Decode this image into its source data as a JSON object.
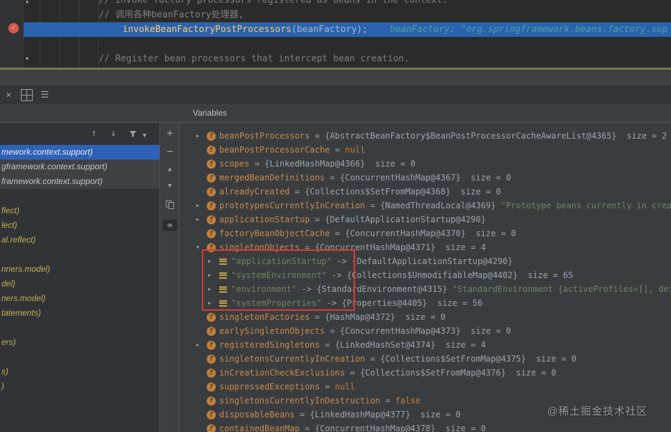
{
  "watermark": "@稀土掘金技术社区",
  "colors": {
    "execution_line_bg": "#2a62ae",
    "breakpoint_red": "#d5574e",
    "frame_selection_bg": "#2e62b8",
    "annotation_box_red": "#e0392f",
    "string_green": "#6a8759",
    "variable_name_orange": "#c98a4b",
    "keyword_orange": "#cc7832",
    "comment_gray": "#7f7f7f",
    "library_frame_yellow": "#c7ae4e"
  },
  "editor": {
    "lines": [
      "// invoke factory processors registered as beans in the context.",
      "// 调用各种beanFactory处理器,",
      "",
      "// Register bean processors that intercept bean creation."
    ],
    "method_name": "invokeBeanFactoryPostProcessors",
    "method_rest": "(beanFactory);",
    "inline_hint": "beanFactory: \"org.springframework.beans.factory.sup",
    "icons": [
      "fold-arrow-icon",
      "verified-breakpoint-icon"
    ]
  },
  "debug": {
    "variables_label": "Variables",
    "left_toolbar_icons": [
      "close-icon",
      "grid-layout-icon",
      "list-layout-icon"
    ],
    "frames_toolbar_icons": [
      "up-arrow-icon",
      "down-arrow-icon",
      "filter-funnel-icon",
      "chevron-down-icon"
    ],
    "side_toolbar_icons": [
      "add-watch-icon",
      "remove-watch-icon",
      "scroll-up-icon",
      "scroll-down-icon",
      "duplicate-icon",
      "evaluate-infinity-icon"
    ],
    "frames": [
      {
        "text": "mework.context.support)",
        "kind": "selected"
      },
      {
        "text": "gframework.context.support)",
        "kind": "normal"
      },
      {
        "text": "framework.context.support)",
        "kind": "normal"
      },
      {
        "text": "",
        "kind": "blank"
      },
      {
        "text": "flect)",
        "kind": "lib"
      },
      {
        "text": "lect)",
        "kind": "lib"
      },
      {
        "text": "al.reflect)",
        "kind": "lib"
      },
      {
        "text": "",
        "kind": "blank"
      },
      {
        "text": "nners.model)",
        "kind": "lib"
      },
      {
        "text": "del)",
        "kind": "lib"
      },
      {
        "text": "ners.model)",
        "kind": "lib"
      },
      {
        "text": "tatements)",
        "kind": "lib"
      },
      {
        "text": "",
        "kind": "blank"
      },
      {
        "text": "ers)",
        "kind": "lib"
      },
      {
        "text": "",
        "kind": "blank"
      },
      {
        "text": "s)",
        "kind": "lib"
      },
      {
        "text": ")",
        "kind": "lib"
      }
    ],
    "variables": [
      {
        "expand": "right",
        "kind": "field",
        "indent": 0,
        "name": "beanPostProcessors",
        "value": "{AbstractBeanFactory$BeanPostProcessorCacheAwareList@4365}",
        "size": "size = 2"
      },
      {
        "expand": "none",
        "kind": "field",
        "indent": 0,
        "name": "beanPostProcessorCache",
        "keyword": "null"
      },
      {
        "expand": "none",
        "kind": "field",
        "indent": 0,
        "name": "scopes",
        "value": "{LinkedHashMap@4366}",
        "size": "size = 0"
      },
      {
        "expand": "none",
        "kind": "field",
        "indent": 0,
        "name": "mergedBeanDefinitions",
        "value": "{ConcurrentHashMap@4367}",
        "size": "size = 0"
      },
      {
        "expand": "none",
        "kind": "field",
        "indent": 0,
        "name": "alreadyCreated",
        "value": "{Collections$SetFromMap@4368}",
        "size": "size = 0"
      },
      {
        "expand": "right",
        "kind": "field",
        "indent": 0,
        "name": "prototypesCurrentlyInCreation",
        "value": "{NamedThreadLocal@4369}",
        "string": "\"Prototype beans currently in creation\""
      },
      {
        "expand": "right",
        "kind": "field",
        "indent": 0,
        "name": "applicationStartup",
        "value": "{DefaultApplicationStartup@4290}"
      },
      {
        "expand": "none",
        "kind": "field",
        "indent": 0,
        "name": "factoryBeanObjectCache",
        "value": "{ConcurrentHashMap@4370}",
        "size": "size = 0"
      },
      {
        "expand": "down",
        "kind": "field",
        "indent": 0,
        "name": "singletonObjects",
        "value": "{ConcurrentHashMap@4371}",
        "size": "size = 4"
      },
      {
        "expand": "right",
        "kind": "entry",
        "indent": 1,
        "name": "\"applicationStartup\"",
        "value": "{DefaultApplicationStartup@4290}"
      },
      {
        "expand": "right",
        "kind": "entry",
        "indent": 1,
        "name": "\"systemEnvironment\"",
        "value": "{Collections$UnmodifiableMap@4402}",
        "size": "size = 65"
      },
      {
        "expand": "right",
        "kind": "entry",
        "indent": 1,
        "name": "\"environment\"",
        "value": "{StandardEnvironment@4315}",
        "string": "\"StandardEnvironment {activeProfiles=[], defaultProfiles=[de"
      },
      {
        "expand": "right",
        "kind": "entry",
        "indent": 1,
        "name": "\"systemProperties\"",
        "value": "{Properties@4405}",
        "size": "size = 56"
      },
      {
        "expand": "none",
        "kind": "field",
        "indent": 0,
        "name": "singletonFactories",
        "value": "{HashMap@4372}",
        "size": "size = 0"
      },
      {
        "expand": "none",
        "kind": "field",
        "indent": 0,
        "name": "earlySingletonObjects",
        "value": "{ConcurrentHashMap@4373}",
        "size": "size = 0"
      },
      {
        "expand": "right",
        "kind": "field",
        "indent": 0,
        "name": "registeredSingletons",
        "value": "{LinkedHashSet@4374}",
        "size": "size = 4"
      },
      {
        "expand": "none",
        "kind": "field",
        "indent": 0,
        "name": "singletonsCurrentlyInCreation",
        "value": "{Collections$SetFromMap@4375}",
        "size": "size = 0"
      },
      {
        "expand": "none",
        "kind": "field",
        "indent": 0,
        "name": "inCreationCheckExclusions",
        "value": "{Collections$SetFromMap@4376}",
        "size": "size = 0"
      },
      {
        "expand": "none",
        "kind": "field",
        "indent": 0,
        "name": "suppressedExceptions",
        "keyword": "null"
      },
      {
        "expand": "none",
        "kind": "field",
        "indent": 0,
        "name": "singletonsCurrentlyInDestruction",
        "keyword": "false"
      },
      {
        "expand": "none",
        "kind": "field",
        "indent": 0,
        "name": "disposableBeans",
        "value": "{LinkedHashMap@4377}",
        "size": "size = 0"
      },
      {
        "expand": "none",
        "kind": "field",
        "indent": 0,
        "name": "containedBeanMap",
        "value": "{ConcurrentHashMap@4378}",
        "size": "size = 0"
      }
    ]
  }
}
